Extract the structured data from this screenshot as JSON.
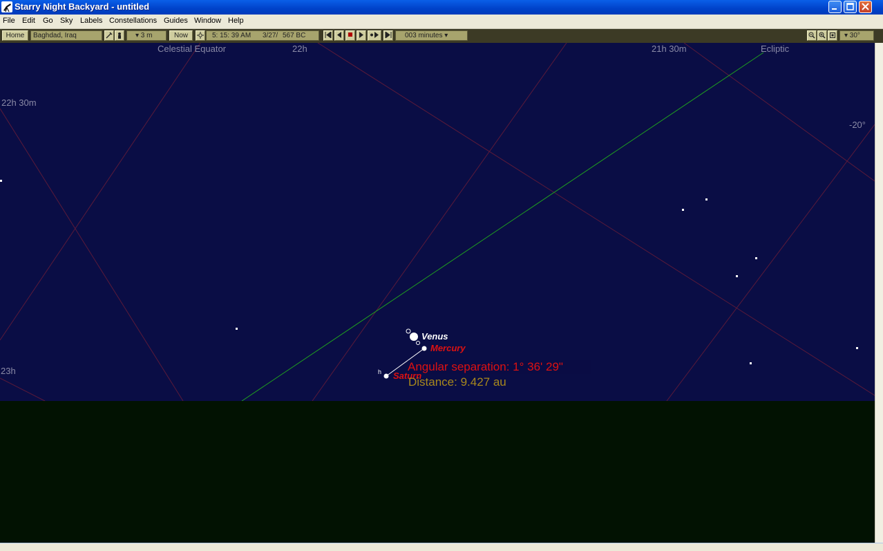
{
  "window": {
    "title": "Starry Night Backyard - untitled",
    "app_icon": "telescope-icon"
  },
  "menu": [
    "File",
    "Edit",
    "Go",
    "Sky",
    "Labels",
    "Constellations",
    "Guides",
    "Window",
    "Help"
  ],
  "toolbar": {
    "home_label": "Home",
    "location": "Baghdad, Iraq",
    "elevation": "▾ 3 m",
    "now_label": "Now",
    "time": "5: 15: 39 AM",
    "date": "3/27/",
    "year": "567 BC",
    "time_step": "003 minutes ▾",
    "field_of_view": "▾ 30°"
  },
  "sky": {
    "grid_labels": {
      "celestial_equator": "Celestial Equator",
      "ra_22h": "22h",
      "ra_21h30m": "21h 30m",
      "ecliptic": "Ecliptic",
      "ra_22h30m": "22h 30m",
      "dec_minus20": "-20°",
      "ra_23h": "23h"
    },
    "planets": {
      "venus": "Venus",
      "mercury": "Mercury",
      "saturn": "Saturn"
    },
    "saturn_symbol": "h",
    "measurement": {
      "separation": "Angular separation: 1° 36' 29\"",
      "distance": "Distance: 9.427 au"
    }
  },
  "colors": {
    "sky": "#0a0d45",
    "ground": "#021202",
    "grid": "#5a1a3a",
    "ecliptic": "#1fa01f",
    "measurement_text": "#d11111",
    "distance_text": "#a8881c",
    "venus_label": "#ffffff",
    "planet_label": "#dd1111"
  }
}
